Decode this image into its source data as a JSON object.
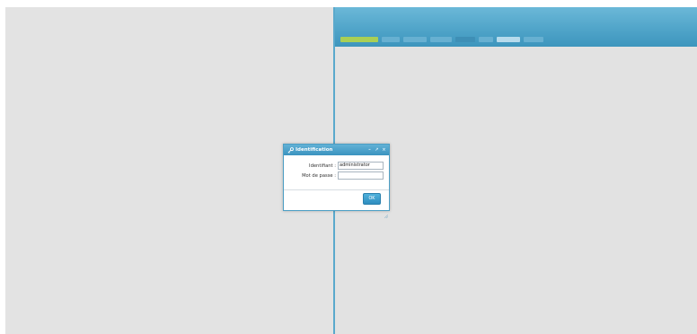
{
  "dialog": {
    "title": "Identification",
    "fields": [
      {
        "label": "Identifiant :",
        "value": "administrator"
      },
      {
        "label": "Mot de passe :",
        "value": ""
      }
    ],
    "ok_label": "OK",
    "title_buttons": [
      "–",
      "↗",
      "×"
    ]
  },
  "icons": {
    "title_icon": "key-icon",
    "resize_icon": "resize-grip-icon"
  },
  "colors": {
    "accent": "#4ea3c8",
    "active_menu": "#a9cf55"
  }
}
